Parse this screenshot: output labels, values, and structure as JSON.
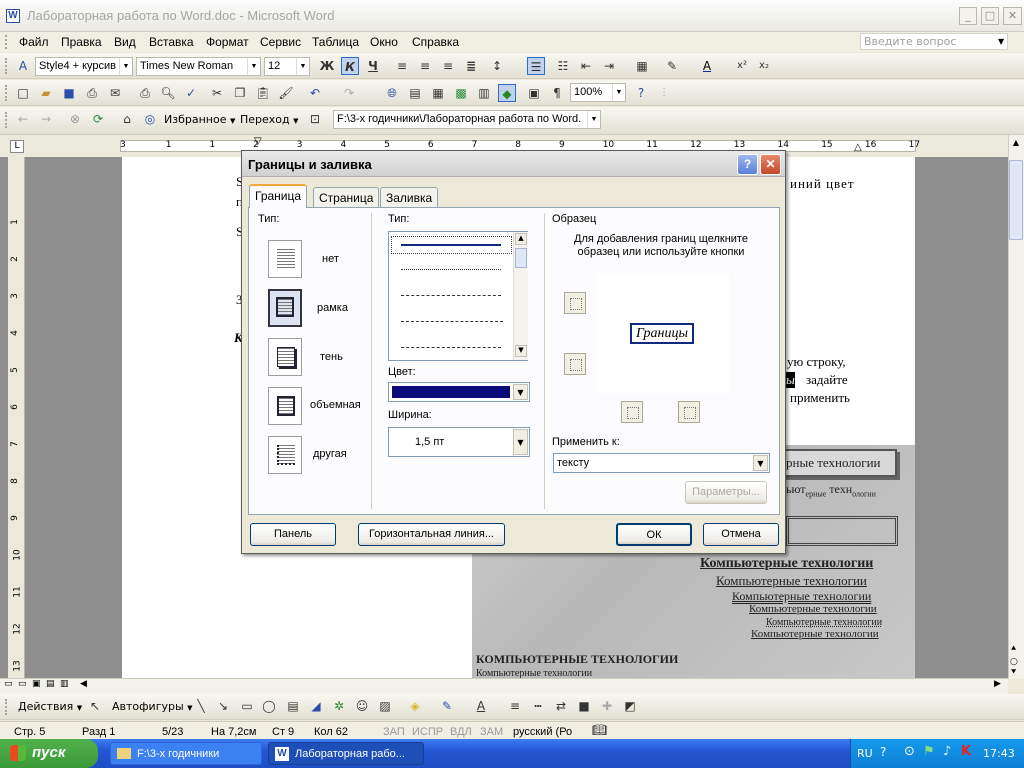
{
  "window": {
    "title": "Лабораторная работа по Word.doc - Microsoft Word",
    "app_icon": "W"
  },
  "menu": [
    "Файл",
    "Правка",
    "Вид",
    "Вставка",
    "Формат",
    "Сервис",
    "Таблица",
    "Окно",
    "Справка"
  ],
  "ask_placeholder": "Введите вопрос",
  "format_bar": {
    "style": "Style4 + курсив",
    "font": "Times New Roman",
    "size": "12"
  },
  "standard_bar": {
    "zoom": "100%"
  },
  "web_bar": {
    "favorites": "Избранное",
    "go": "Переход",
    "address": "F:\\3-х годичники\\Лабораторная работа по Word."
  },
  "document_text": {
    "line1_right": "иний цвет",
    "line2_left": "п",
    "line3_left": "S",
    "line4_left": "3",
    "line5_left": "К",
    "right1": "ую строку,",
    "right2_word": "ы",
    "right2": "задайте",
    "right3": "применить"
  },
  "scan_text": {
    "line_a": "рные технологии",
    "line_b_start": "ьют",
    "line_b_sub1": "ерные",
    "line_b_mid": "техн",
    "line_b_sub2": "ологии",
    "l1": "Компьютерные технологии",
    "l2": "Компьютерные технологии",
    "l3": "Компьютерные технологии",
    "l4": "Компьютерные технологии",
    "l5": "Компьютерные технологии",
    "l6": "Компьютерные технологии",
    "caps": "КОМПЬЮТЕРНЫЕ ТЕХНОЛОГИИ",
    "caps_sub": "Компьютерные технологии"
  },
  "ruler_numbers": [
    "3",
    "1",
    "1",
    "2",
    "3",
    "4",
    "5",
    "6",
    "7",
    "8",
    "9",
    "10",
    "11",
    "12",
    "13",
    "14",
    "15",
    "16",
    "17"
  ],
  "vruler_numbers": [
    "1",
    "2",
    "3",
    "4",
    "5",
    "6",
    "7",
    "8",
    "9",
    "10",
    "11",
    "12",
    "13"
  ],
  "dialog": {
    "title": "Границы и заливка",
    "tabs": [
      {
        "label": "Граница",
        "active": true
      },
      {
        "label": "Страница",
        "active": false
      },
      {
        "label": "Заливка",
        "active": false
      }
    ],
    "type_label": "Тип:",
    "settings": [
      {
        "label": "нет"
      },
      {
        "label": "рамка",
        "selected": true
      },
      {
        "label": "тень"
      },
      {
        "label": "объемная"
      },
      {
        "label": "другая"
      }
    ],
    "style_label": "Тип:",
    "color_label": "Цвет:",
    "color_value": "#0a0a7a",
    "width_label": "Ширина:",
    "width_value": "1,5 пт",
    "preview_label": "Образец",
    "preview_hint": "Для добавления границ щелкните образец или используйте кнопки",
    "preview_word": "Границы",
    "apply_label": "Применить к:",
    "apply_value": "тексту",
    "params": "Параметры...",
    "panel": "Панель",
    "hline": "Горизонтальная линия...",
    "ok": "ОК",
    "cancel": "Отмена"
  },
  "drawing_bar": {
    "actions": "Действия",
    "autoshapes": "Автофигуры"
  },
  "status": {
    "page": "Стр. 5",
    "section": "Разд 1",
    "pages": "5/23",
    "at": "На 7,2см",
    "line": "Ст 9",
    "col": "Кол 62",
    "rec": "ЗАП",
    "trk": "ИСПР",
    "ext": "ВДЛ",
    "ovr": "ЗАМ",
    "lang": "русский (Ро"
  },
  "taskbar": {
    "start": "пуск",
    "task1": "F:\\3-х годичники",
    "task2": "Лабораторная рабо...",
    "lang": "RU",
    "clock": "17:43"
  }
}
